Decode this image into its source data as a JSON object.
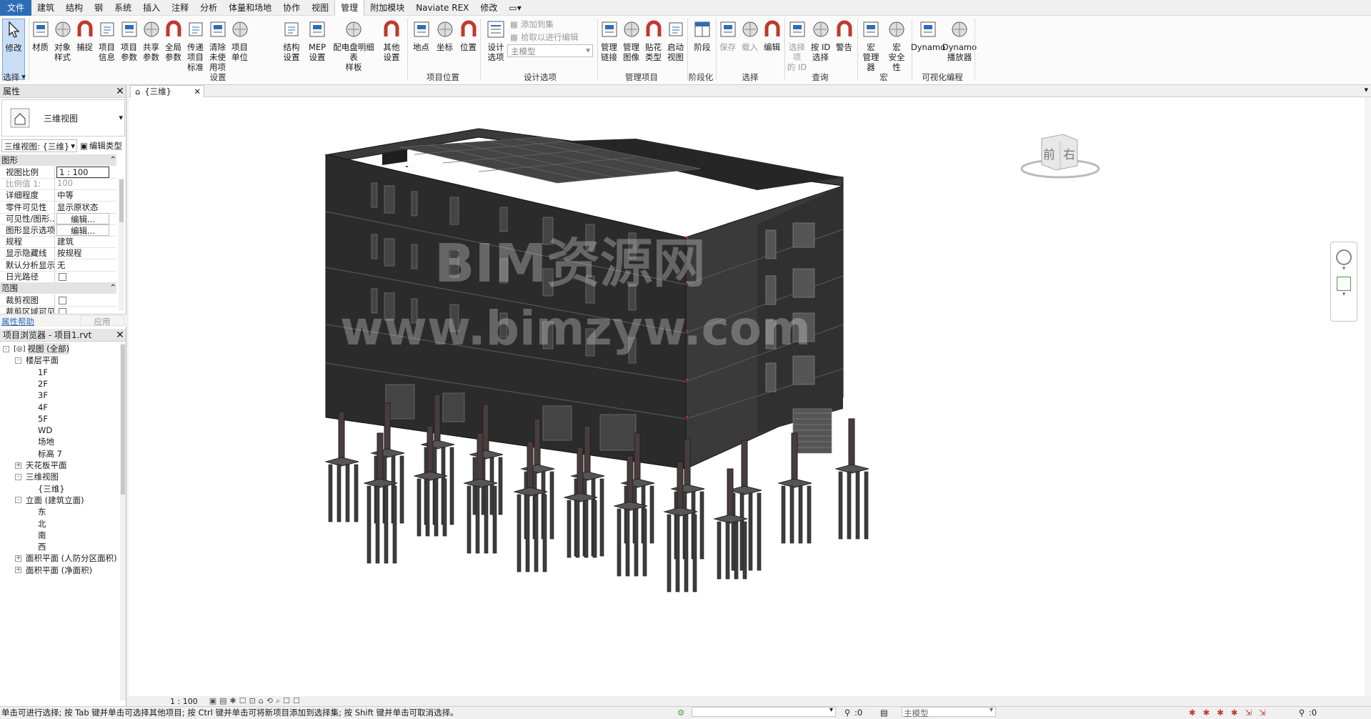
{
  "menu": {
    "items": [
      "文件",
      "建筑",
      "结构",
      "钢",
      "系统",
      "插入",
      "注释",
      "分析",
      "体量和场地",
      "协作",
      "视图",
      "管理",
      "附加模块",
      "Naviate REX",
      "修改"
    ],
    "active": "管理"
  },
  "ribbon": {
    "select": {
      "modify_line1": "修改",
      "group": "选择"
    },
    "settings_tools": [
      {
        "l1": "材质",
        "l2": ""
      },
      {
        "l1": "对象",
        "l2": "样式"
      },
      {
        "l1": "捕捉",
        "l2": ""
      },
      {
        "l1": "项目",
        "l2": "信息"
      },
      {
        "l1": "项目",
        "l2": "参数"
      },
      {
        "l1": "共享",
        "l2": "参数"
      },
      {
        "l1": "全局",
        "l2": "参数"
      },
      {
        "l1": "传递",
        "l2": "项目标准"
      },
      {
        "l1": "清除",
        "l2": "未使用项"
      },
      {
        "l1": "项目",
        "l2": "单位"
      }
    ],
    "settings_tools2": [
      {
        "l1": "结构",
        "l2": "设置"
      },
      {
        "l1": "MEP",
        "l2": "设置"
      },
      {
        "l1": "配电盘明细表",
        "l2": "样板"
      },
      {
        "l1": "其他",
        "l2": "设置"
      }
    ],
    "group_settings": "设置",
    "location_tools": [
      {
        "l1": "地点"
      },
      {
        "l1": "坐标"
      },
      {
        "l1": "位置"
      }
    ],
    "group_location": "项目位置",
    "design": {
      "l1": "设计",
      "l2": "选项",
      "add_to_set": "添加到集",
      "pick_to_edit": "拾取以进行编辑",
      "main_model": "主模型",
      "group": "设计选项"
    },
    "manage_project": [
      {
        "l1": "管理",
        "l2": "链接"
      },
      {
        "l1": "管理",
        "l2": "图像"
      },
      {
        "l1": "贴花",
        "l2": "类型"
      },
      {
        "l1": "启动",
        "l2": "视图"
      }
    ],
    "group_manage_project": "管理项目",
    "phasing": {
      "l1": "阶段",
      "group": "阶段化"
    },
    "selection": [
      {
        "l1": "保存"
      },
      {
        "l1": "载入"
      },
      {
        "l1": "编辑"
      }
    ],
    "group_selection": "选择",
    "inquiry": [
      {
        "l1": "选择项",
        "l2": "的 ID"
      },
      {
        "l1": "按 ID",
        "l2": "选择"
      },
      {
        "l1": "警告",
        "l2": ""
      }
    ],
    "group_inquiry": "查询",
    "macros": [
      {
        "l1": "宏",
        "l2": "管理器"
      },
      {
        "l1": "宏",
        "l2": "安全性"
      }
    ],
    "group_macros": "宏",
    "dynamo": [
      {
        "l1": "Dynamo",
        "l2": ""
      },
      {
        "l1": "Dynamo",
        "l2": "播放器"
      }
    ],
    "group_dynamo": "可视化编程"
  },
  "properties": {
    "title": "属性",
    "type_name": "三维视图",
    "view_selector": "三维视图: {三维}",
    "edit_type": "编辑类型",
    "section_graphics": "图形",
    "rows": [
      {
        "k": "视图比例",
        "v": "1 : 100"
      },
      {
        "k": "比例值 1:",
        "v": "100"
      },
      {
        "k": "详细程度",
        "v": "中等"
      },
      {
        "k": "零件可见性",
        "v": "显示原状态"
      },
      {
        "k": "可见性/图形...",
        "v": "编辑..."
      },
      {
        "k": "图形显示选项",
        "v": "编辑..."
      },
      {
        "k": "规程",
        "v": "建筑"
      },
      {
        "k": "显示隐藏线",
        "v": "按规程"
      },
      {
        "k": "默认分析显示...",
        "v": "无"
      },
      {
        "k": "日光路径",
        "v": ""
      }
    ],
    "section_extents": "范围",
    "rows2": [
      {
        "k": "裁剪视图",
        "v": ""
      },
      {
        "k": "裁剪区域可见",
        "v": ""
      }
    ],
    "help": "属性帮助",
    "apply": "应用"
  },
  "browser": {
    "title": "项目浏览器 - 项目1.rvt",
    "nodes": [
      {
        "t": "视图 (全部)",
        "lvl": 0,
        "exp": "-"
      },
      {
        "t": "楼层平面",
        "lvl": 1,
        "exp": "-"
      },
      {
        "t": "1F",
        "lvl": 2,
        "exp": ""
      },
      {
        "t": "2F",
        "lvl": 2,
        "exp": ""
      },
      {
        "t": "3F",
        "lvl": 2,
        "exp": ""
      },
      {
        "t": "4F",
        "lvl": 2,
        "exp": ""
      },
      {
        "t": "5F",
        "lvl": 2,
        "exp": ""
      },
      {
        "t": "WD",
        "lvl": 2,
        "exp": ""
      },
      {
        "t": "场地",
        "lvl": 2,
        "exp": ""
      },
      {
        "t": "标高 7",
        "lvl": 2,
        "exp": ""
      },
      {
        "t": "天花板平面",
        "lvl": 1,
        "exp": "+"
      },
      {
        "t": "三维视图",
        "lvl": 1,
        "exp": "-"
      },
      {
        "t": "{三维}",
        "lvl": 2,
        "exp": ""
      },
      {
        "t": "立面 (建筑立面)",
        "lvl": 1,
        "exp": "-"
      },
      {
        "t": "东",
        "lvl": 2,
        "exp": ""
      },
      {
        "t": "北",
        "lvl": 2,
        "exp": ""
      },
      {
        "t": "南",
        "lvl": 2,
        "exp": ""
      },
      {
        "t": "西",
        "lvl": 2,
        "exp": ""
      },
      {
        "t": "面积平面 (人防分区面积)",
        "lvl": 1,
        "exp": "+"
      },
      {
        "t": "面积平面 (净面积)",
        "lvl": 1,
        "exp": "+"
      }
    ]
  },
  "view": {
    "tab": "{三维}",
    "watermark1": "BIM资源网",
    "watermark2": "www.bimzyw.com",
    "viewcube_front": "前",
    "viewcube_right": "右",
    "scale": "1 : 100"
  },
  "status": {
    "message": "单击可进行选择; 按 Tab 键并单击可选择其他项目; 按 Ctrl 键并单击可将新项目添加到选择集; 按 Shift 键并单击可取消选择。",
    "counter": ":0",
    "model": "主模型",
    "filter": ":0"
  },
  "colors": {
    "file_tab": "#2d6db5",
    "building": "#2e2e2e",
    "selected": "#c9def5"
  }
}
